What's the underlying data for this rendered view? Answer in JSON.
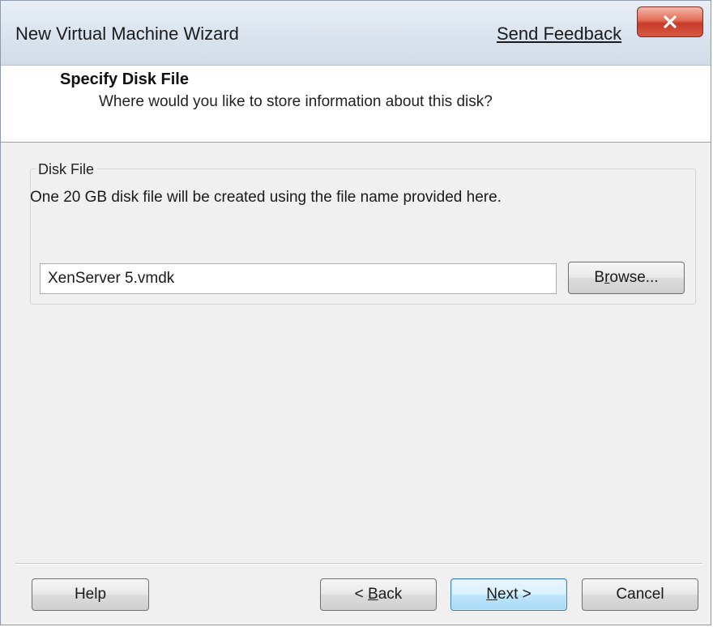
{
  "window": {
    "title": "New Virtual Machine Wizard",
    "feedback_link": "Send Feedback",
    "close_icon": "close-icon"
  },
  "header": {
    "title": "Specify Disk File",
    "subtitle": "Where would you like to store information about this disk?"
  },
  "disk_file": {
    "group_label": "Disk File",
    "description": "One 20 GB disk file will be created using the file name provided here.",
    "file_name_value": "XenServer 5.vmdk",
    "browse_label_pre": "B",
    "browse_label_accel": "r",
    "browse_label_post": "owse..."
  },
  "footer": {
    "help_label": "Help",
    "back_label_pre": "< ",
    "back_label_accel": "B",
    "back_label_post": "ack",
    "next_label_accel": "N",
    "next_label_post": "ext >",
    "cancel_label": "Cancel"
  },
  "colors": {
    "close_button": "#d65a44",
    "default_button_border": "#3c7fb1",
    "dialog_background": "#f0f0f0"
  }
}
